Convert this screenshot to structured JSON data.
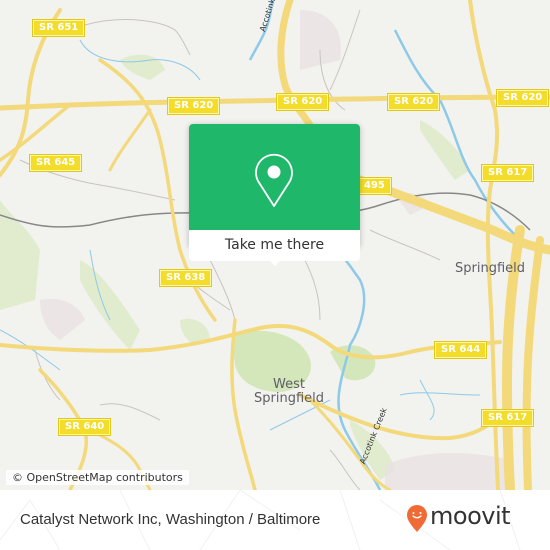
{
  "map": {
    "route_shields": [
      {
        "label": "SR 651"
      },
      {
        "label": "SR 620"
      },
      {
        "label": "SR 620"
      },
      {
        "label": "SR 620"
      },
      {
        "label": "SR 620"
      },
      {
        "label": "SR 645"
      },
      {
        "label": "495"
      },
      {
        "label": "SR 617"
      },
      {
        "label": "SR 638"
      },
      {
        "label": "SR 644"
      },
      {
        "label": "SR 640"
      },
      {
        "label": "SR 617"
      }
    ],
    "place_labels": {
      "springfield": "Springfield",
      "west_springfield_line1": "West",
      "west_springfield_line2": "Springfield"
    },
    "creek_labels": {
      "top": "Accotink Creek",
      "bottom": "Accotink Creek"
    },
    "attribution": "© OpenStreetMap contributors",
    "colors": {
      "background": "#f2f2ee",
      "road": "#f6de5c",
      "water": "#8dc9e8",
      "park": "#c9e3a7",
      "popup_green": "#1fb86a"
    }
  },
  "popup": {
    "icon": "map-pin-icon",
    "button_label": "Take me there"
  },
  "footer": {
    "title": "Catalyst Network Inc, Washington / Baltimore",
    "brand": "moovit",
    "brand_color": "#f06a35"
  }
}
